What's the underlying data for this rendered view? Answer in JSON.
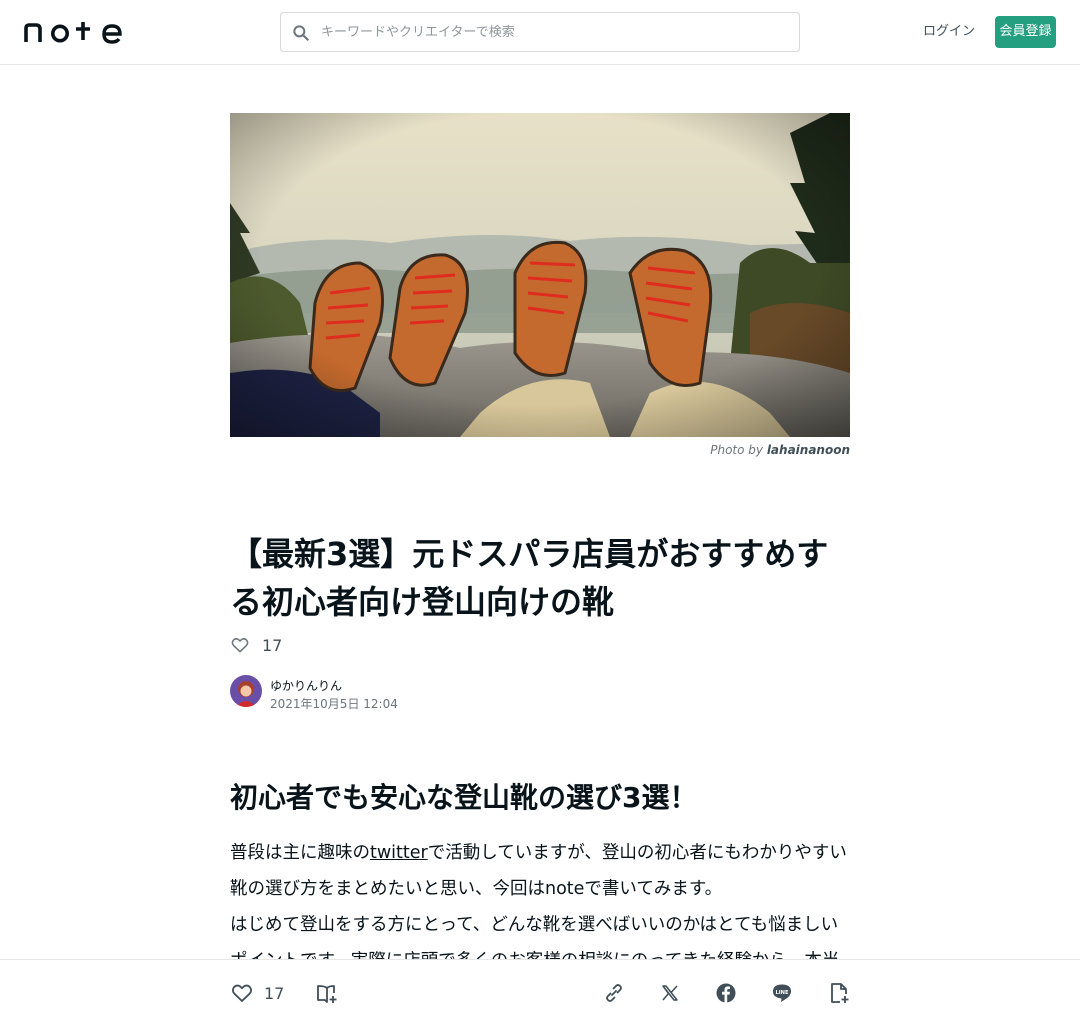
{
  "header": {
    "logo_text": "note",
    "search_placeholder": "キーワードやクリエイターで検索",
    "login_label": "ログイン",
    "signup_label": "会員登録"
  },
  "hero": {
    "credit_prefix": "Photo by ",
    "credit_author": "lahainanoon"
  },
  "article": {
    "title": "【最新3選】元ドスパラ店員がおすすめする初心者向け登山向けの靴",
    "like_count": "17",
    "author_name": "ゆかりんりん",
    "date": "2021年10月5日 12:04",
    "heading": "初心者でも安心な登山靴の選び3選！",
    "para1_before_link": "普段は主に趣味のtwitter",
    "para1_link": "twitter",
    "para1_after_link": "で活動していますが、登山の初心者にもわかりやすい靴の選び方をまとめたいと思い、今回はnoteで書いてみます。",
    "para2": "はじめて登山をする方にとって、どんな靴を選べばいいのかはとても悩ましいポイントです。実際に店頭で多くのお客様の相談にのってきた経験から、本当におすすめできる靴を紹介します。"
  },
  "bottom_bar": {
    "like_count": "17"
  },
  "icons": {
    "search": "search-icon",
    "heart": "heart-icon",
    "magazine": "magazine-add-icon",
    "link": "link-icon",
    "x": "x-logo-icon",
    "facebook": "facebook-icon",
    "line": "line-icon",
    "note_add": "note-add-icon"
  },
  "colors": {
    "brand_green": "#249f80",
    "text": "#08131a",
    "muted": "#6c757b"
  }
}
